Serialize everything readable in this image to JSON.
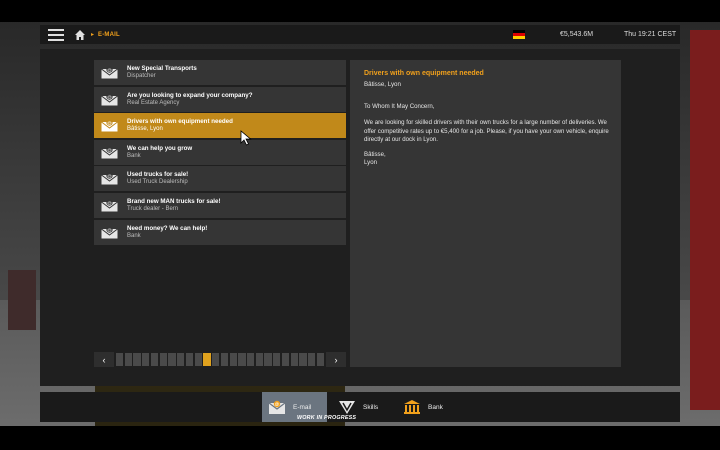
{
  "topbar": {
    "breadcrumb": "E-MAIL",
    "money": "€5,543.6M",
    "clock": "Thu 19:21 CEST",
    "flag": [
      "#000000",
      "#dd0000",
      "#ffce00"
    ]
  },
  "emails": [
    {
      "subject": "New Special Transports",
      "sender": "Dispatcher",
      "icon": "envelope-icon"
    },
    {
      "subject": "Are you looking to expand your company?",
      "sender": "Real Estate Agency",
      "icon": "envelope-icon"
    },
    {
      "subject": "Drivers with own equipment needed",
      "sender": "Bâtisse, Lyon",
      "icon": "envelope-open-icon",
      "selected": true
    },
    {
      "subject": "We can help you grow",
      "sender": "Bank",
      "icon": "envelope-icon"
    },
    {
      "subject": "Used trucks for sale!",
      "sender": "Used Truck Dealership",
      "icon": "envelope-icon"
    },
    {
      "subject": "Brand new MAN trucks for sale!",
      "sender": "Truck dealer - Bern",
      "icon": "envelope-icon"
    },
    {
      "subject": "Need money? We can help!",
      "sender": "Bank",
      "icon": "envelope-icon"
    }
  ],
  "detail": {
    "subject": "Drivers with own equipment needed",
    "from": "Bâtisse, Lyon",
    "salutation": "To Whom It May Concern,",
    "body": "We are looking for skilled drivers with their own trucks for a large number of deliveries. We offer competitive rates up to €5,400 for a job. Please, if you have your own vehicle, enquire directly at our dock in Lyon.",
    "signature_name": "Bâtisse,",
    "signature_city": "Lyon"
  },
  "pager": {
    "prev": "‹",
    "next": "›",
    "pages": 24,
    "current": 10
  },
  "nav": {
    "email": "E-mail",
    "skills": "Skills",
    "bank": "Bank",
    "wip": "WORK IN PROGRESS"
  },
  "colors": {
    "accent": "#f0a01c",
    "selected": "#c1891a"
  }
}
